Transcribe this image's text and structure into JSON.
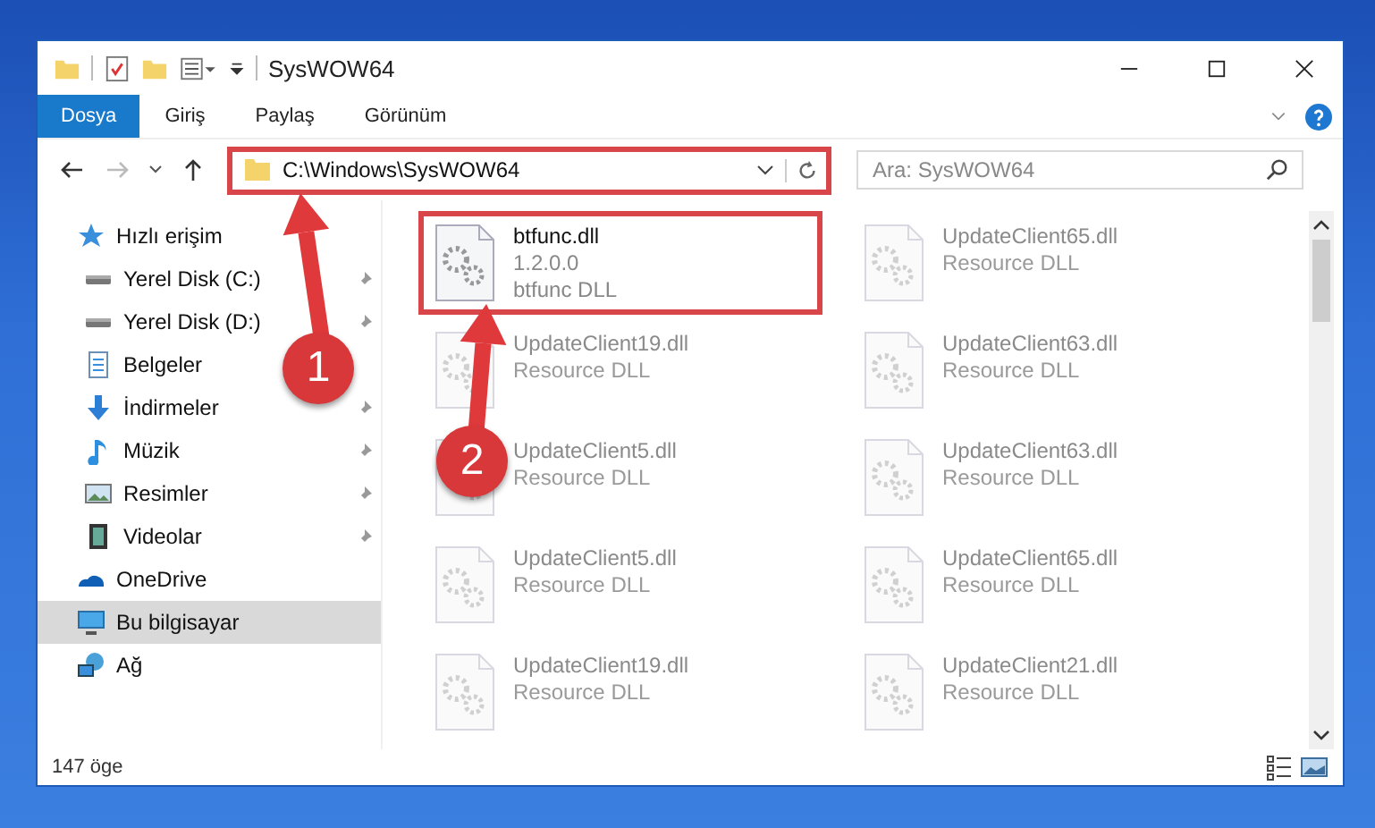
{
  "window": {
    "title": "SysWOW64"
  },
  "ribbon_tabs": [
    {
      "label": "Dosya",
      "selected": true
    },
    {
      "label": "Giriş",
      "selected": false
    },
    {
      "label": "Paylaş",
      "selected": false
    },
    {
      "label": "Görünüm",
      "selected": false
    }
  ],
  "address_bar": {
    "path": "C:\\Windows\\SysWOW64",
    "highlighted": true
  },
  "search": {
    "placeholder": "Ara: SysWOW64"
  },
  "sidebar": {
    "items": [
      {
        "label": "Hızlı erişim",
        "kind": "star",
        "selected": false,
        "children": [
          {
            "label": "Yerel Disk (C:)",
            "kind": "drive",
            "pinned": true,
            "selected": false
          },
          {
            "label": "Yerel Disk (D:)",
            "kind": "drive",
            "pinned": true,
            "selected": false
          },
          {
            "label": "Belgeler",
            "kind": "document",
            "pinned": false,
            "selected": false
          },
          {
            "label": "İndirmeler",
            "kind": "download",
            "pinned": true,
            "selected": false
          },
          {
            "label": "Müzik",
            "kind": "music",
            "pinned": true,
            "selected": false
          },
          {
            "label": "Resimler",
            "kind": "picture",
            "pinned": true,
            "selected": false
          },
          {
            "label": "Videolar",
            "kind": "video",
            "pinned": true,
            "selected": false
          }
        ]
      },
      {
        "label": "OneDrive",
        "kind": "cloud",
        "selected": false
      },
      {
        "label": "Bu bilgisayar",
        "kind": "computer",
        "selected": true
      },
      {
        "label": "Ağ",
        "kind": "network",
        "selected": false
      }
    ]
  },
  "files": [
    {
      "name": "btfunc.dll",
      "lines": [
        "1.2.0.0",
        "btfunc DLL"
      ],
      "highlighted": true,
      "faded": false
    },
    {
      "name": "UpdateClient65.dll",
      "lines": [
        "Resource DLL"
      ],
      "highlighted": false,
      "faded": true
    },
    {
      "name": "UpdateClient19.dll",
      "lines": [
        "Resource DLL"
      ],
      "highlighted": false,
      "faded": true
    },
    {
      "name": "UpdateClient63.dll",
      "lines": [
        "Resource DLL"
      ],
      "highlighted": false,
      "faded": true
    },
    {
      "name": "UpdateClient5.dll",
      "lines": [
        "Resource DLL"
      ],
      "highlighted": false,
      "faded": true
    },
    {
      "name": "UpdateClient63.dll",
      "lines": [
        "Resource DLL"
      ],
      "highlighted": false,
      "faded": true
    },
    {
      "name": "UpdateClient5.dll",
      "lines": [
        "Resource DLL"
      ],
      "highlighted": false,
      "faded": true
    },
    {
      "name": "UpdateClient65.dll",
      "lines": [
        "Resource DLL"
      ],
      "highlighted": false,
      "faded": true
    },
    {
      "name": "UpdateClient19.dll",
      "lines": [
        "Resource DLL"
      ],
      "highlighted": false,
      "faded": true
    },
    {
      "name": "UpdateClient21.dll",
      "lines": [
        "Resource DLL"
      ],
      "highlighted": false,
      "faded": true
    }
  ],
  "status_bar": {
    "count": "147 öge"
  },
  "callouts": [
    {
      "label": "1"
    },
    {
      "label": "2"
    }
  ]
}
